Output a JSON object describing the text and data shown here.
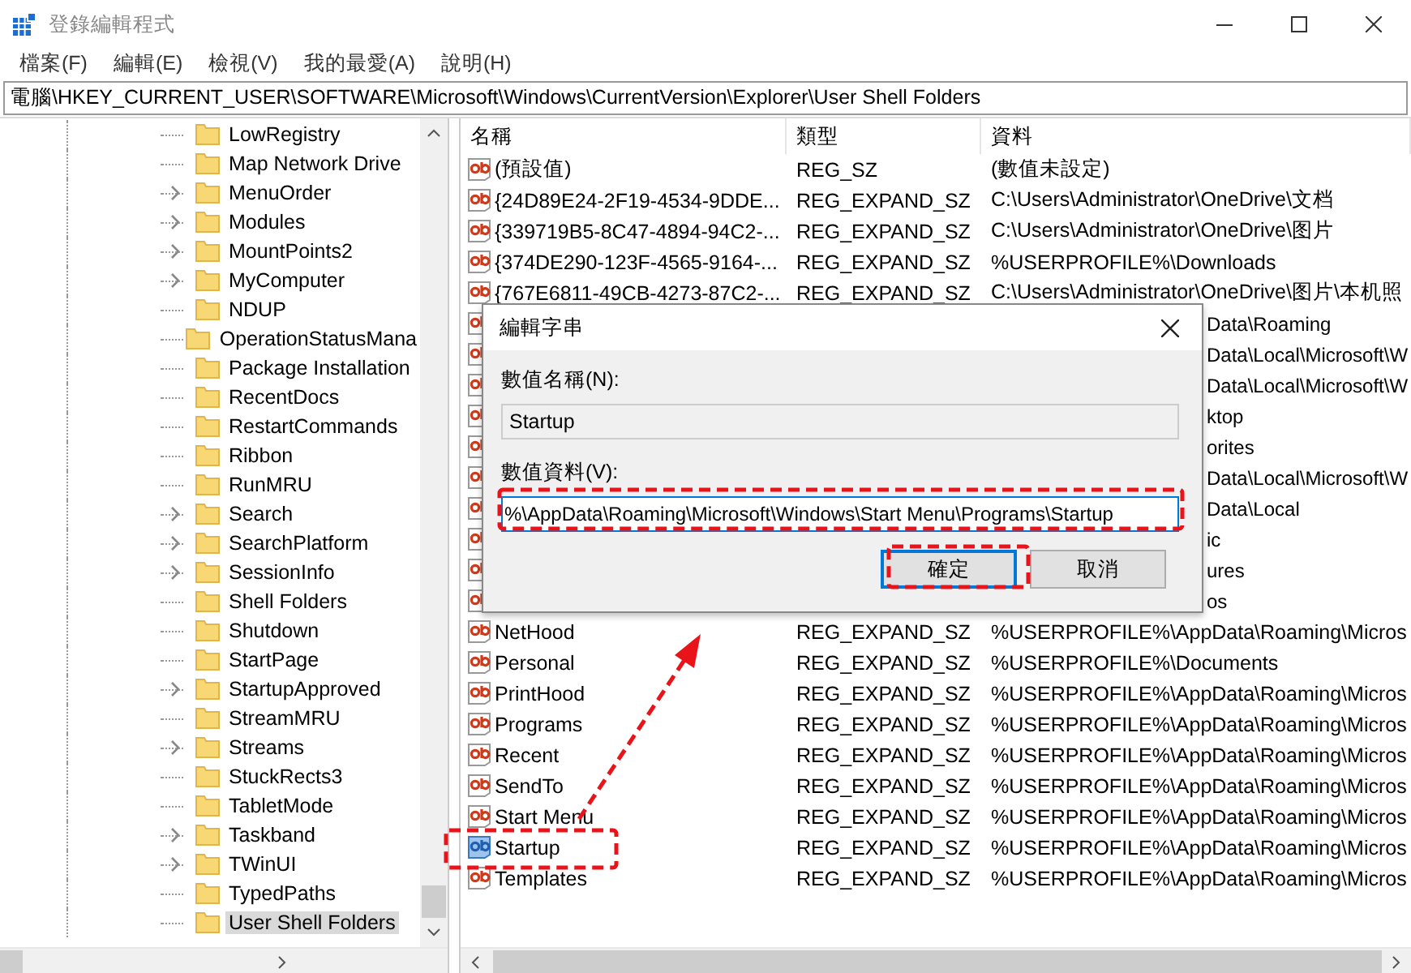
{
  "window": {
    "title": "登錄編輯程式"
  },
  "menu": [
    "檔案(F)",
    "編輯(E)",
    "檢視(V)",
    "我的最愛(A)",
    "說明(H)"
  ],
  "address": "電腦\\HKEY_CURRENT_USER\\SOFTWARE\\Microsoft\\Windows\\CurrentVersion\\Explorer\\User Shell Folders",
  "tree": {
    "items": [
      {
        "label": "LowRegistry",
        "has_children": false,
        "selected": false
      },
      {
        "label": "Map Network Drive",
        "has_children": false,
        "selected": false
      },
      {
        "label": "MenuOrder",
        "has_children": true,
        "selected": false
      },
      {
        "label": "Modules",
        "has_children": true,
        "selected": false
      },
      {
        "label": "MountPoints2",
        "has_children": true,
        "selected": false
      },
      {
        "label": "MyComputer",
        "has_children": true,
        "selected": false
      },
      {
        "label": "NDUP",
        "has_children": false,
        "selected": false
      },
      {
        "label": "OperationStatusMana",
        "has_children": false,
        "selected": false
      },
      {
        "label": "Package Installation",
        "has_children": false,
        "selected": false
      },
      {
        "label": "RecentDocs",
        "has_children": false,
        "selected": false
      },
      {
        "label": "RestartCommands",
        "has_children": false,
        "selected": false
      },
      {
        "label": "Ribbon",
        "has_children": false,
        "selected": false
      },
      {
        "label": "RunMRU",
        "has_children": false,
        "selected": false
      },
      {
        "label": "Search",
        "has_children": true,
        "selected": false
      },
      {
        "label": "SearchPlatform",
        "has_children": true,
        "selected": false
      },
      {
        "label": "SessionInfo",
        "has_children": true,
        "selected": false
      },
      {
        "label": "Shell Folders",
        "has_children": false,
        "selected": false
      },
      {
        "label": "Shutdown",
        "has_children": false,
        "selected": false
      },
      {
        "label": "StartPage",
        "has_children": false,
        "selected": false
      },
      {
        "label": "StartupApproved",
        "has_children": true,
        "selected": false
      },
      {
        "label": "StreamMRU",
        "has_children": false,
        "selected": false
      },
      {
        "label": "Streams",
        "has_children": true,
        "selected": false
      },
      {
        "label": "StuckRects3",
        "has_children": false,
        "selected": false
      },
      {
        "label": "TabletMode",
        "has_children": false,
        "selected": false
      },
      {
        "label": "Taskband",
        "has_children": true,
        "selected": false
      },
      {
        "label": "TWinUI",
        "has_children": true,
        "selected": false
      },
      {
        "label": "TypedPaths",
        "has_children": false,
        "selected": false
      },
      {
        "label": "User Shell Folders",
        "has_children": false,
        "selected": true
      }
    ]
  },
  "table": {
    "columns": [
      "名稱",
      "類型",
      "資料"
    ],
    "rows": [
      {
        "kind": "full",
        "name": "(預設值)",
        "type": "REG_SZ",
        "data": "(數值未設定)",
        "selected": false
      },
      {
        "kind": "full",
        "name": "{24D89E24-2F19-4534-9DDE...",
        "type": "REG_EXPAND_SZ",
        "data": "C:\\Users\\Administrator\\OneDrive\\文档",
        "selected": false
      },
      {
        "kind": "full",
        "name": "{339719B5-8C47-4894-94C2-...",
        "type": "REG_EXPAND_SZ",
        "data": "C:\\Users\\Administrator\\OneDrive\\图片",
        "selected": false
      },
      {
        "kind": "full",
        "name": "{374DE290-123F-4565-9164-...",
        "type": "REG_EXPAND_SZ",
        "data": "%USERPROFILE%\\Downloads",
        "selected": false
      },
      {
        "kind": "full",
        "name": "{767E6811-49CB-4273-87C2-...",
        "type": "REG_EXPAND_SZ",
        "data": "C:\\Users\\Administrator\\OneDrive\\图片\\本机照",
        "selected": false
      },
      {
        "kind": "covered",
        "data": "Data\\Roaming",
        "selected": false
      },
      {
        "kind": "covered",
        "data": "Data\\Local\\Microsoft\\W",
        "selected": false
      },
      {
        "kind": "covered",
        "data": "Data\\Local\\Microsoft\\W",
        "selected": false
      },
      {
        "kind": "covered",
        "data": "ktop",
        "selected": false
      },
      {
        "kind": "covered",
        "data": "orites",
        "selected": false
      },
      {
        "kind": "covered",
        "data": "Data\\Local\\Microsoft\\W",
        "selected": false
      },
      {
        "kind": "covered",
        "data": "Data\\Local",
        "selected": false
      },
      {
        "kind": "covered",
        "data": "ic",
        "selected": false
      },
      {
        "kind": "covered",
        "data": "ures",
        "selected": false
      },
      {
        "kind": "covered",
        "data": "os",
        "selected": false
      },
      {
        "kind": "full",
        "name": "NetHood",
        "type": "REG_EXPAND_SZ",
        "data": "%USERPROFILE%\\AppData\\Roaming\\Micros",
        "selected": false
      },
      {
        "kind": "full",
        "name": "Personal",
        "type": "REG_EXPAND_SZ",
        "data": "%USERPROFILE%\\Documents",
        "selected": false
      },
      {
        "kind": "full",
        "name": "PrintHood",
        "type": "REG_EXPAND_SZ",
        "data": "%USERPROFILE%\\AppData\\Roaming\\Micros",
        "selected": false
      },
      {
        "kind": "full",
        "name": "Programs",
        "type": "REG_EXPAND_SZ",
        "data": "%USERPROFILE%\\AppData\\Roaming\\Micros",
        "selected": false
      },
      {
        "kind": "full",
        "name": "Recent",
        "type": "REG_EXPAND_SZ",
        "data": "%USERPROFILE%\\AppData\\Roaming\\Micros",
        "selected": false
      },
      {
        "kind": "full",
        "name": "SendTo",
        "type": "REG_EXPAND_SZ",
        "data": "%USERPROFILE%\\AppData\\Roaming\\Micros",
        "selected": false
      },
      {
        "kind": "full",
        "name": "Start Menu",
        "type": "REG_EXPAND_SZ",
        "data": "%USERPROFILE%\\AppData\\Roaming\\Micros",
        "selected": false
      },
      {
        "kind": "full",
        "name": "Startup",
        "type": "REG_EXPAND_SZ",
        "data": "%USERPROFILE%\\AppData\\Roaming\\Micros",
        "selected": true
      },
      {
        "kind": "full",
        "name": "Templates",
        "type": "REG_EXPAND_SZ",
        "data": "%USERPROFILE%\\AppData\\Roaming\\Micros",
        "selected": false
      }
    ]
  },
  "dialog": {
    "title": "編輯字串",
    "name_label": "數值名稱(N):",
    "name_value": "Startup",
    "data_label": "數值資料(V):",
    "data_value": "%\\AppData\\Roaming\\Microsoft\\Windows\\Start Menu\\Programs\\Startup",
    "buttons": [
      {
        "label": "確定",
        "default": true
      },
      {
        "label": "取消",
        "default": false
      }
    ]
  }
}
